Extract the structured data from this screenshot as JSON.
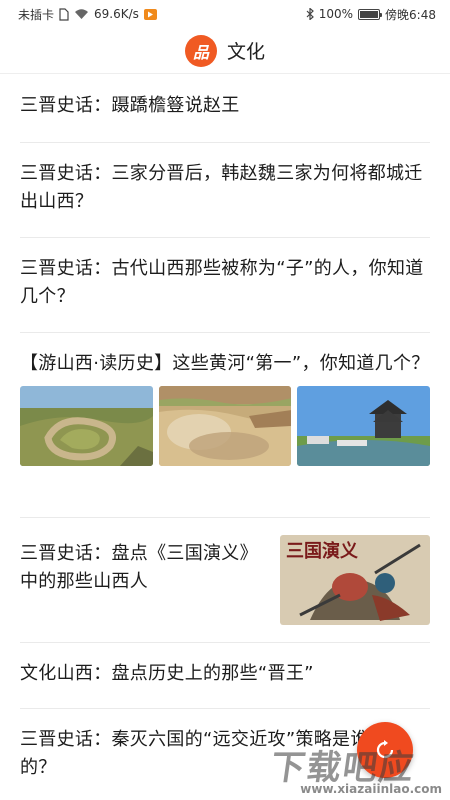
{
  "status_bar": {
    "carrier": "未插卡",
    "net_speed": "69.6K/s",
    "battery_level": 1.0,
    "battery_text": "100%",
    "time": "傍晚6:48"
  },
  "header": {
    "logo_char": "品",
    "title": "文化"
  },
  "feed": [
    {
      "title": "三晋史话：蹑蹻檐簦说赵王"
    },
    {
      "title": "三晋史话：三家分晋后，韩赵魏三家为何将都城迁出山西？"
    },
    {
      "title": "三晋史话：古代山西那些被称为“子”的人，你知道几个？"
    },
    {
      "title": "【游山西·读历史】这些黄河“第一”，你知道几个？"
    },
    {
      "title": "三晋史话：盘点《三国演义》中的那些山西人",
      "image_caption": "三国演义"
    },
    {
      "title": "文化山西：盘点历史上的那些“晋王”"
    },
    {
      "title": "三晋史话：秦灭六国的“远交近攻”策略是谁提出的？"
    }
  ],
  "watermark": {
    "main": "下载吧应用",
    "url": "www.xiazaiinlao.com"
  },
  "colors": {
    "brand": "#f05a23",
    "divider": "#eaeaea"
  }
}
